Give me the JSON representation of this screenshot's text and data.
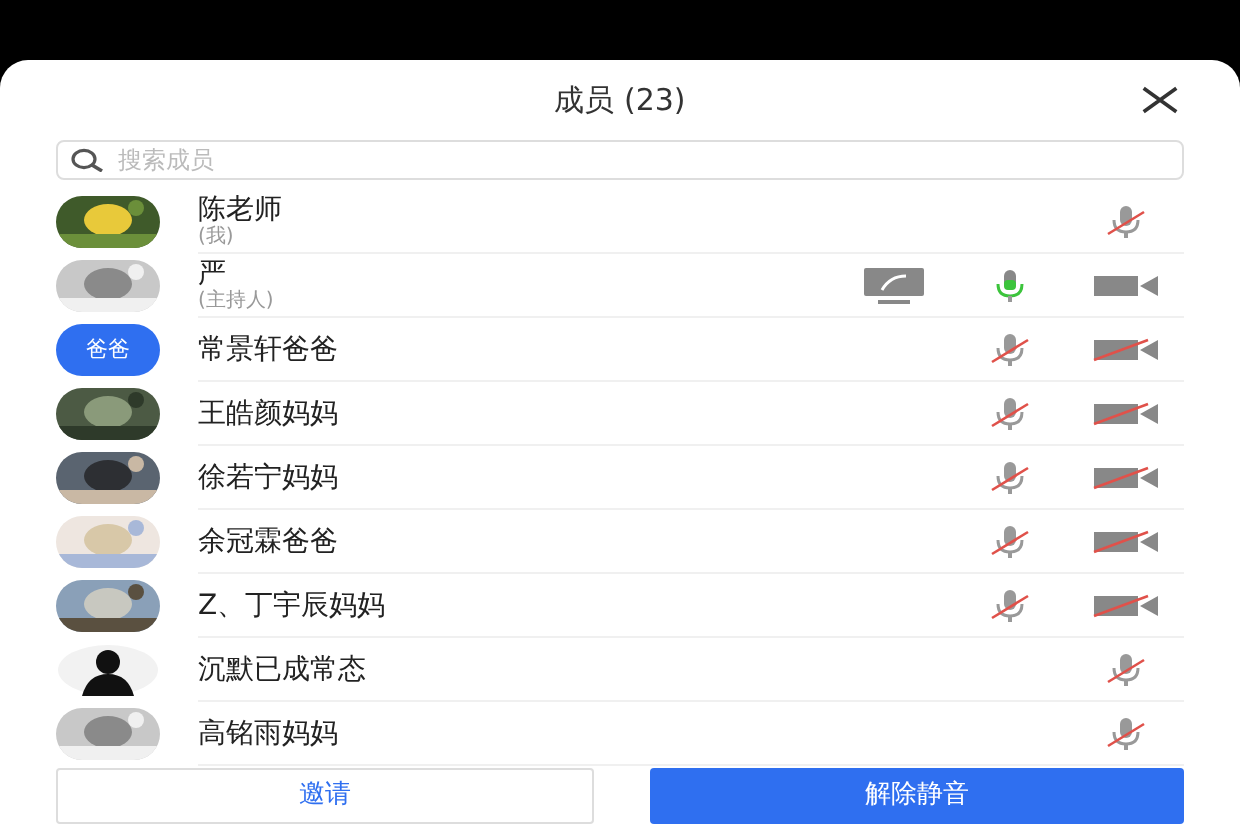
{
  "header": {
    "title": "成员 (23)"
  },
  "search": {
    "placeholder": "搜索成员"
  },
  "members": [
    {
      "name": "陈老师",
      "role": "(我)",
      "sharing": false,
      "mic": {
        "on": false
      }
    },
    {
      "name": "严",
      "role": "(主持人)",
      "sharing": true,
      "mic": {
        "on": true
      },
      "camera": {
        "on": true
      }
    },
    {
      "name": "常景轩爸爸",
      "avatar": {
        "kind": "text",
        "text": "爸爸"
      },
      "sharing": false,
      "mic": {
        "on": false
      },
      "camera": {
        "on": false
      }
    },
    {
      "name": "王皓颜妈妈",
      "sharing": false,
      "mic": {
        "on": false
      },
      "camera": {
        "on": false
      }
    },
    {
      "name": "徐若宁妈妈",
      "sharing": false,
      "mic": {
        "on": false
      },
      "camera": {
        "on": false
      }
    },
    {
      "name": "余冠霖爸爸",
      "sharing": false,
      "mic": {
        "on": false
      },
      "camera": {
        "on": false
      }
    },
    {
      "name": "Z、丁宇辰妈妈",
      "sharing": false,
      "mic": {
        "on": false
      },
      "camera": {
        "on": false
      }
    },
    {
      "name": "沉默已成常态",
      "avatar": {
        "kind": "silhouette"
      },
      "sharing": false,
      "mic": {
        "on": false
      }
    },
    {
      "name": "高铭雨妈妈",
      "sharing": false,
      "mic": {
        "on": false
      }
    }
  ],
  "buttons": [
    {
      "label": "邀请",
      "kind": "secondary"
    },
    {
      "label": "解除静音",
      "kind": "primary"
    }
  ]
}
